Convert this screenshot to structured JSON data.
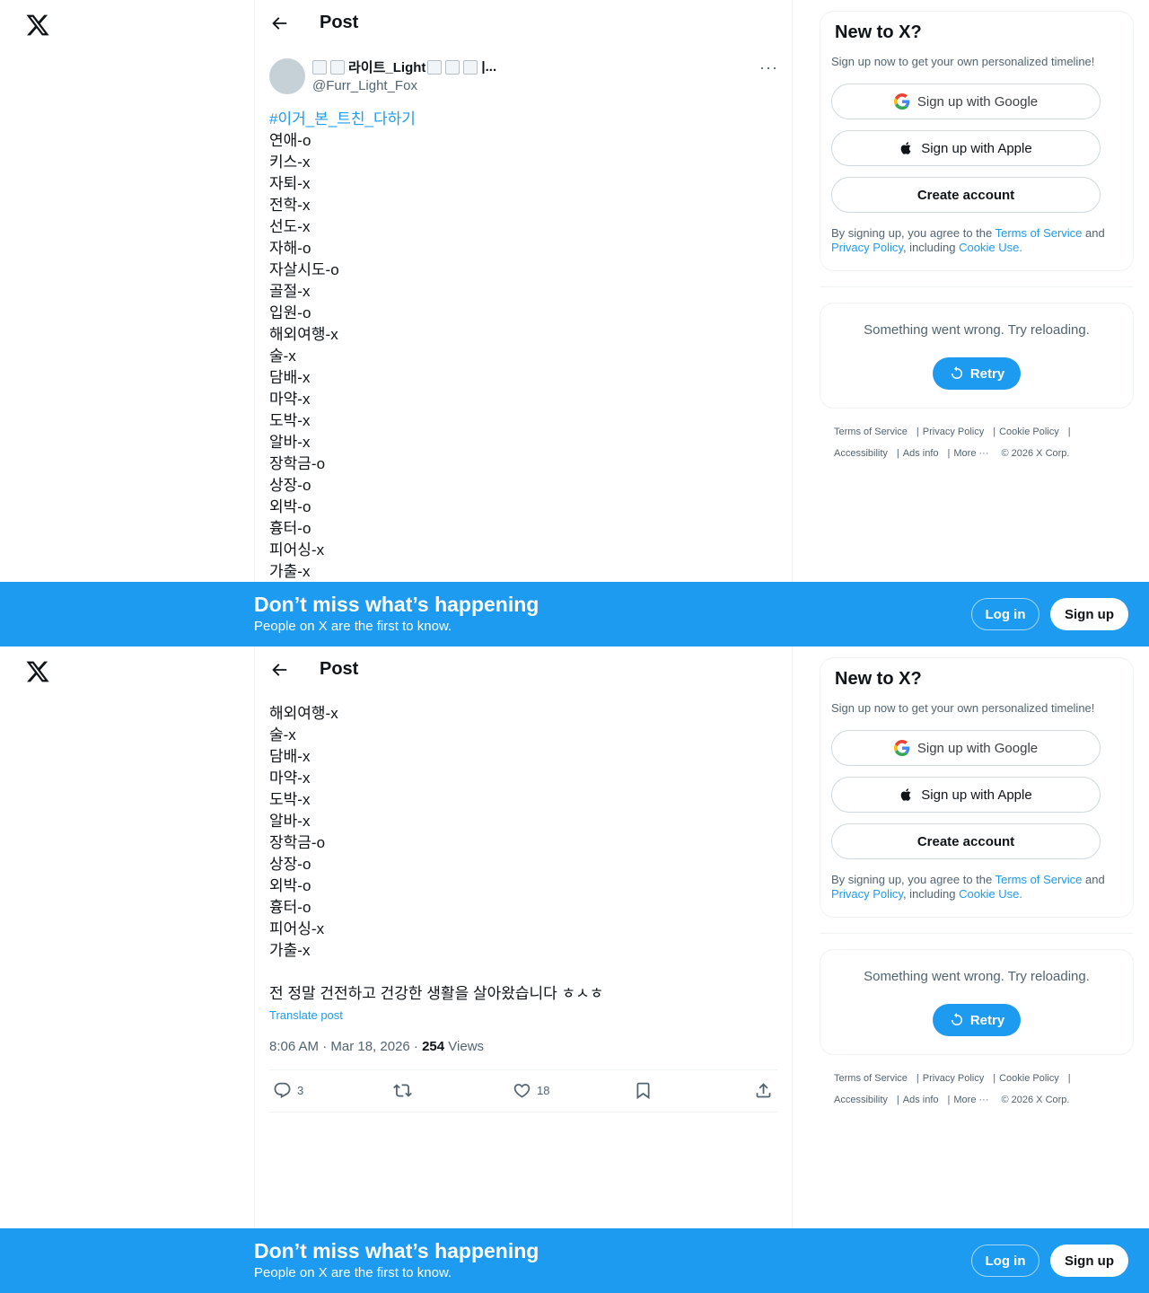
{
  "nav": {
    "logo": "x-logo"
  },
  "header": {
    "title": "Post"
  },
  "author": {
    "display_name": "라이트_Light",
    "display_trail": "|...",
    "handle": "@Furr_Light_Fox"
  },
  "post": {
    "hashtag": "#이거_본_트친_다하기",
    "lines": [
      "연애-o",
      "키스-x",
      "자퇴-x",
      "전학-x",
      "선도-x",
      "자해-o",
      "자살시도-o",
      "골절-x",
      "입원-o",
      "해외여행-x",
      "술-x",
      "담배-x",
      "마약-x",
      "도박-x",
      "알바-x",
      "장학금-o",
      "상장-o",
      "외박-o",
      "흉터-o",
      "피어싱-x",
      "가출-x"
    ],
    "closing": "전 정말 건전하고 건강한 생활을 살아왔습니다 ㅎㅅㅎ",
    "translate": "Translate post",
    "timestamp": "8:06 AM · Mar 18, 2026 · ",
    "views_count": "254",
    "views_label": " Views",
    "replies": "3",
    "likes": "18"
  },
  "signup_card": {
    "title": "New to X?",
    "subtitle": "Sign up now to get your own personalized timeline!",
    "google": "Sign up with Google",
    "apple": "Sign up with Apple",
    "create": "Create account",
    "terms_prefix": "By signing up, you agree to the ",
    "terms_link": "Terms of Service",
    "terms_and": " and ",
    "privacy_link": "Privacy Policy",
    "terms_including": ", including ",
    "cookie_link": "Cookie Use."
  },
  "error_card": {
    "message": "Something went wrong. Try reloading.",
    "retry": "Retry"
  },
  "footer": {
    "terms": "Terms of Service",
    "privacy": "Privacy Policy",
    "cookie": "Cookie Policy",
    "accessibility": "Accessibility",
    "ads": "Ads info",
    "more": "More ···",
    "copyright": "© 2026 X Corp."
  },
  "banner": {
    "title": "Don’t miss what’s happening",
    "subtitle": "People on X are the first to know.",
    "login": "Log in",
    "signup": "Sign up"
  },
  "colors": {
    "accent": "#1d9bf0",
    "text": "#0f1419",
    "muted": "#536471"
  }
}
